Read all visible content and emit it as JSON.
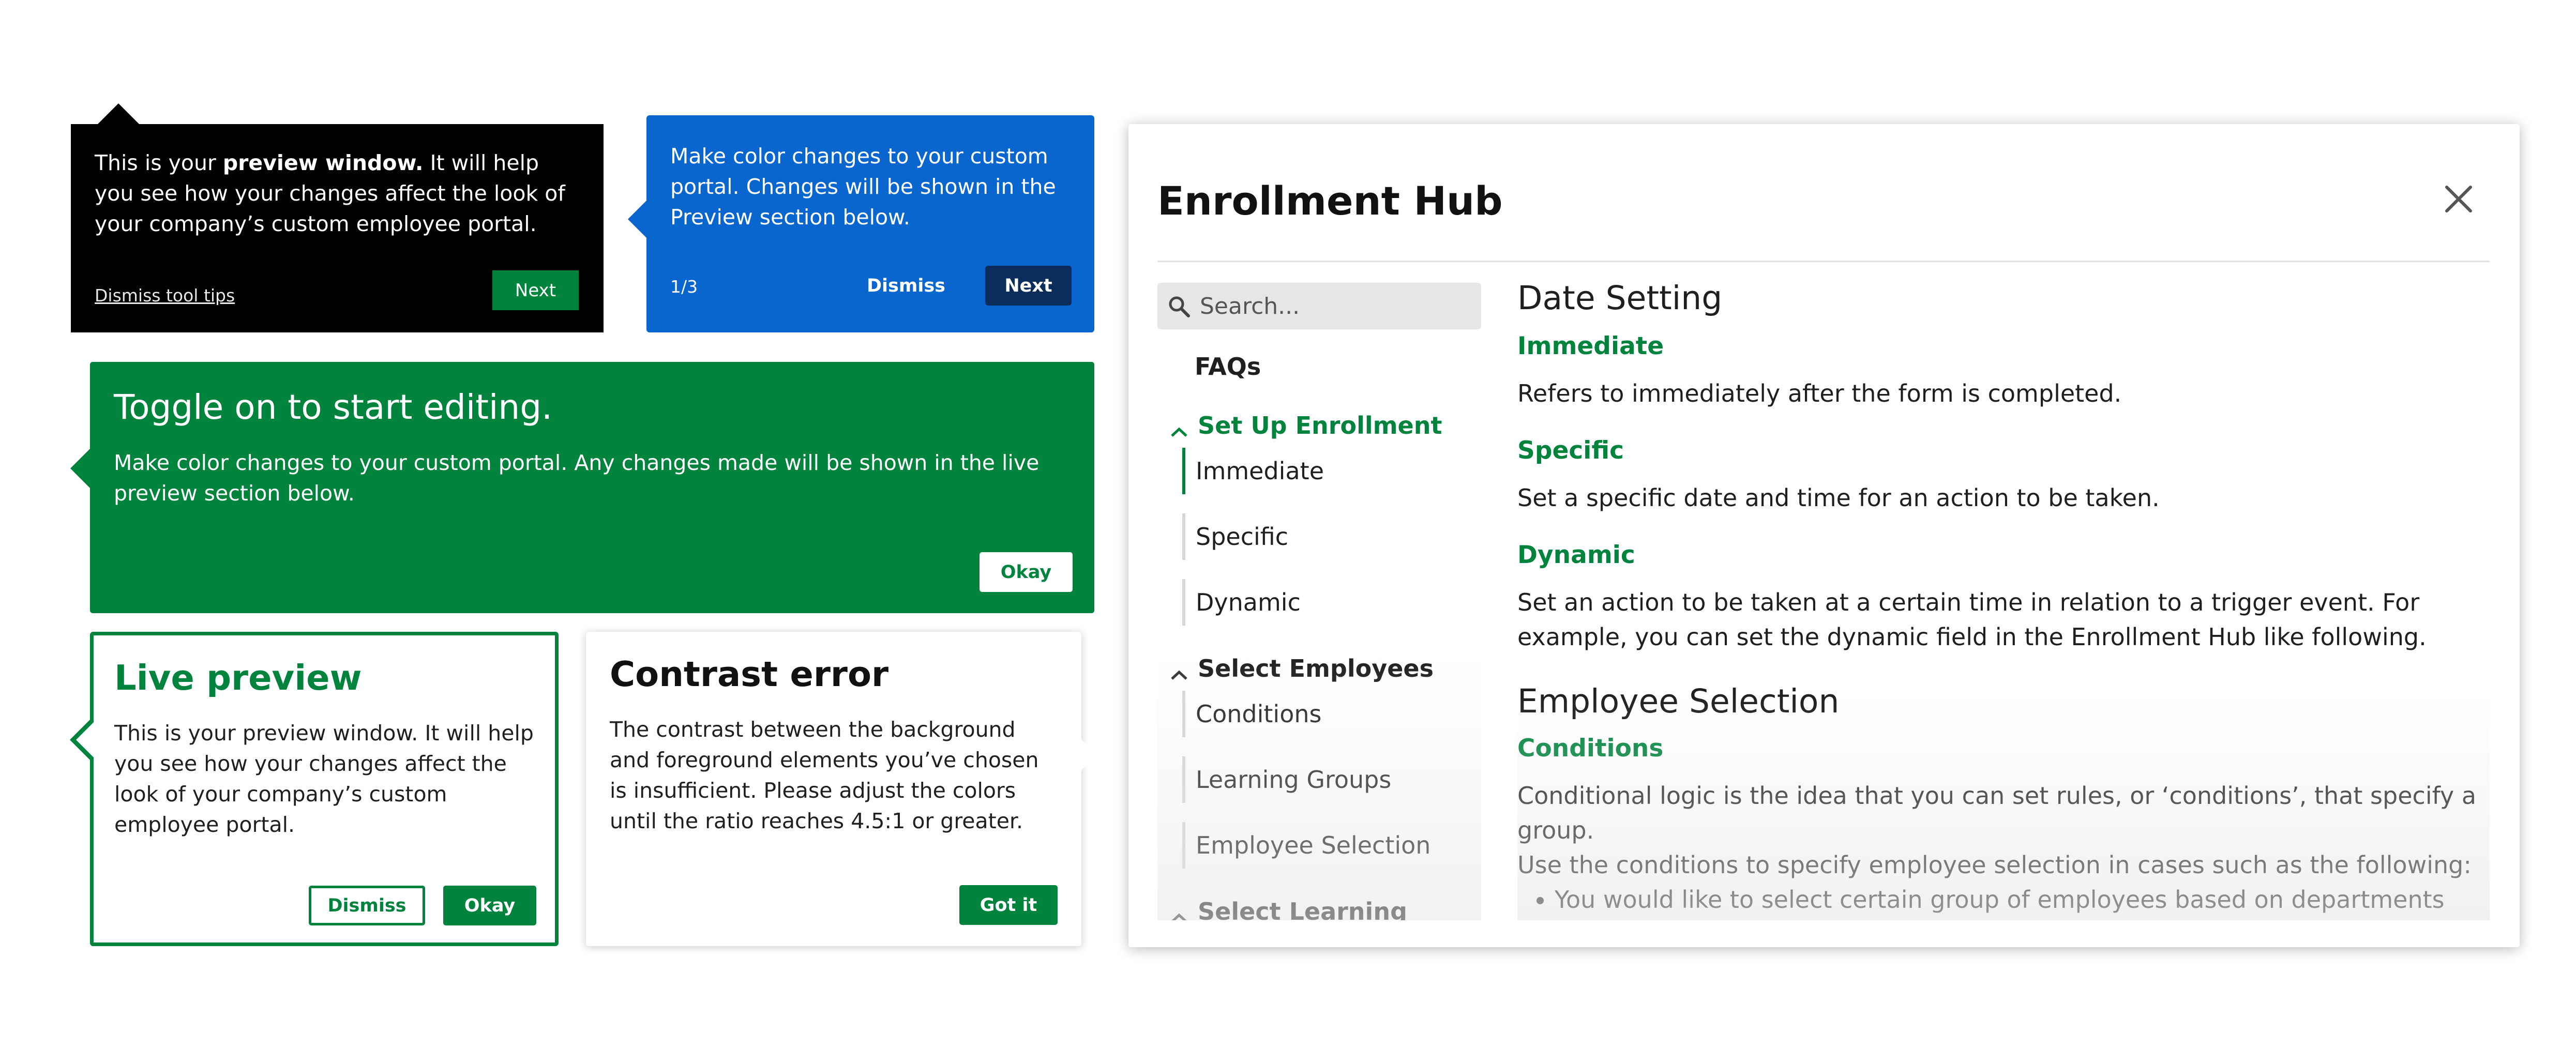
{
  "tooltip_black": {
    "text_before": "This is your ",
    "text_bold": "preview window.",
    "text_after": " It will help you see how your changes affect the look of your company’s custom employee portal.",
    "dismiss_label": "Dismiss tool tips",
    "next_label": "Next"
  },
  "tooltip_blue": {
    "body": "Make color changes to your custom portal. Changes will be shown in the Preview section below.",
    "step_count": "1/3",
    "dismiss_label": "Dismiss",
    "next_label": "Next"
  },
  "tooltip_green": {
    "title": "Toggle on to start editing.",
    "body": "Make color changes to your custom portal. Any changes made will be shown in the live preview section below.",
    "okay_label": "Okay"
  },
  "tooltip_live_preview": {
    "title": "Live preview",
    "body": "This is your preview window. It will help you see how your changes affect the look of your company’s custom employee portal.",
    "dismiss_label": "Dismiss",
    "okay_label": "Okay"
  },
  "tooltip_contrast": {
    "title": "Contrast error",
    "body": "The contrast between the background and foreground elements you’ve chosen is insufficient. Please adjust the colors until the ratio reaches 4.5:1 or greater.",
    "gotit_label": "Got it"
  },
  "modal": {
    "title": "Enrollment Hub",
    "close_icon": "close-icon",
    "search": {
      "placeholder": "Search...",
      "icon": "search-icon"
    },
    "nav": {
      "faqs": "FAQs",
      "sections": [
        {
          "label": "Set Up Enrollment",
          "expanded": true,
          "items": [
            "Immediate",
            "Specific",
            "Dynamic"
          ],
          "active_item": "Immediate"
        },
        {
          "label": "Select Employees",
          "expanded": true,
          "items": [
            "Conditions",
            "Learning Groups",
            "Employee Selection"
          ]
        },
        {
          "label": "Select Learning",
          "expanded": true,
          "items": []
        }
      ]
    },
    "content": {
      "section1_title": "Date Setting",
      "immediate_title": "Immediate",
      "immediate_body": "Refers to immediately after the form is completed.",
      "specific_title": "Specific",
      "specific_body": "Set a specific date and time for an action to be taken.",
      "dynamic_title": "Dynamic",
      "dynamic_body": "Set an action to be taken at a certain time in relation to a trigger event. For example, you can set the dynamic field in the Enrollment Hub like following.",
      "section2_title": "Employee Selection",
      "conditions_title": "Conditions",
      "conditions_body1": "Conditional logic is the idea that you can set rules, or ‘conditions’, that specify a group.",
      "conditions_body2": "Use the conditions to specify employee selection in cases such as the following:",
      "bullets": [
        "You would like to select certain group of employees based on departments"
      ]
    }
  },
  "colors": {
    "brand_green": "#00843d",
    "brand_blue": "#0a66cf",
    "navy": "#0b2d5b",
    "black": "#000000"
  }
}
